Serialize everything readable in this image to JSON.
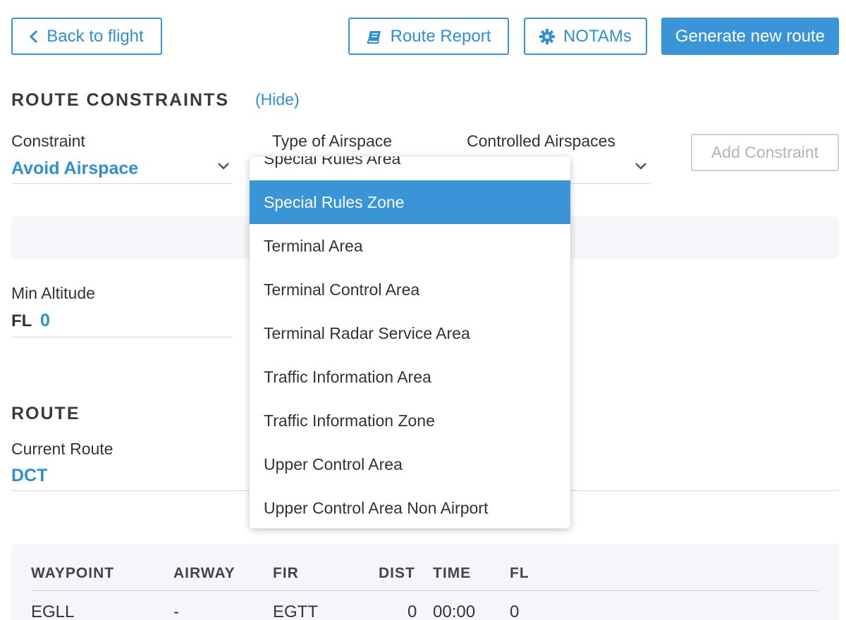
{
  "toolbar": {
    "back_label": "Back to flight",
    "route_report_label": "Route Report",
    "notams_label": "NOTAMs",
    "generate_label": "Generate new route"
  },
  "route_constraints": {
    "title": "ROUTE CONSTRAINTS",
    "hide_label": "(Hide)",
    "constraint_label": "Constraint",
    "constraint_value": "Avoid Airspace",
    "airspace_type_label": "Type of Airspace",
    "controlled_label": "Controlled Airspaces",
    "add_constraint_label": "Add Constraint",
    "min_altitude_label": "Min Altitude",
    "fl_prefix": "FL",
    "min_altitude_value": "0"
  },
  "airspace_dropdown": {
    "items": [
      "Special Rules Area",
      "Special Rules Zone",
      "Terminal Area",
      "Terminal Control Area",
      "Terminal Radar Service Area",
      "Traffic Information Area",
      "Traffic Information Zone",
      "Upper Control Area",
      "Upper Control Area Non Airport"
    ],
    "selected": "Special Rules Zone"
  },
  "route": {
    "title": "ROUTE",
    "current_route_label": "Current Route",
    "current_route_value": "DCT"
  },
  "table": {
    "headers": [
      "WAYPOINT",
      "AIRWAY",
      "FIR",
      "DIST",
      "TIME",
      "FL"
    ],
    "rows": [
      [
        "EGLL",
        "-",
        "EGTT",
        "0",
        "00:00",
        "0"
      ]
    ]
  },
  "colors": {
    "accent": "#3a94d8",
    "text": "#333333",
    "panel": "#f4f6f9",
    "disabled": "#b4b4b4"
  },
  "icons": [
    "chevron-left-icon",
    "book-icon",
    "gear-icon",
    "chevron-down-icon"
  ]
}
